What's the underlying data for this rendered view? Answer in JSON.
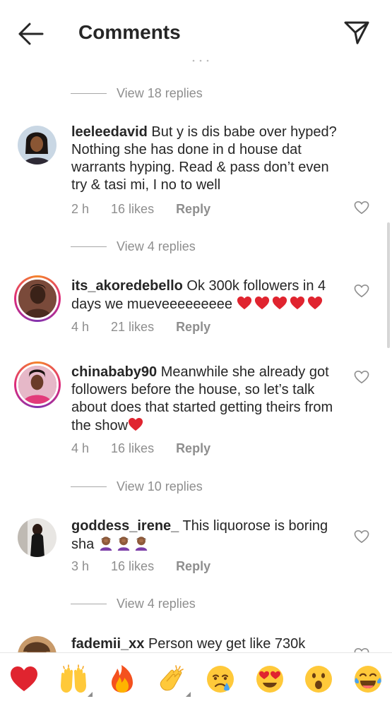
{
  "header": {
    "title": "Comments"
  },
  "replies_links": [
    {
      "label": "View 18 replies"
    },
    {
      "label": "View 4 replies"
    },
    {
      "label": "View 10 replies"
    },
    {
      "label": "View 4 replies"
    }
  ],
  "comments": [
    {
      "username": "leeleedavid",
      "text": "But y is dis babe over hyped? Nothing she has done in d house dat warrants hyping. Read & pass don’t even try & tasi mi, I no to well",
      "time": "2 h",
      "likes": "16 likes",
      "reply": "Reply"
    },
    {
      "username": "its_akoredebello",
      "text": "Ok 300k followers in 4 days we mueveeeeeeeee",
      "time": "4 h",
      "likes": "21 likes",
      "reply": "Reply"
    },
    {
      "username": "chinababy90",
      "text": "Meanwhile she already got followers before the house, so let’s talk about does that started getting theirs from the show",
      "time": "4 h",
      "likes": "16 likes",
      "reply": "Reply"
    },
    {
      "username": "goddess_irene_",
      "text": "This liquorose is boring sha",
      "time": "3 h",
      "likes": "16 likes",
      "reply": "Reply"
    },
    {
      "username": "fademii_xx",
      "text": "Person wey get like 730k"
    }
  ],
  "emoji_bar": [
    {
      "icon": "red-heart-emoji"
    },
    {
      "icon": "raising-hands-emoji"
    },
    {
      "icon": "fire-emoji"
    },
    {
      "icon": "clapping-hands-emoji"
    },
    {
      "icon": "crying-face-emoji"
    },
    {
      "icon": "heart-eyes-emoji"
    },
    {
      "icon": "astonished-face-emoji"
    },
    {
      "icon": "tears-of-joy-emoji"
    }
  ],
  "colors": {
    "text": "#262626",
    "secondary": "#8e8e8e",
    "heart_red": "#ed2e3d"
  }
}
